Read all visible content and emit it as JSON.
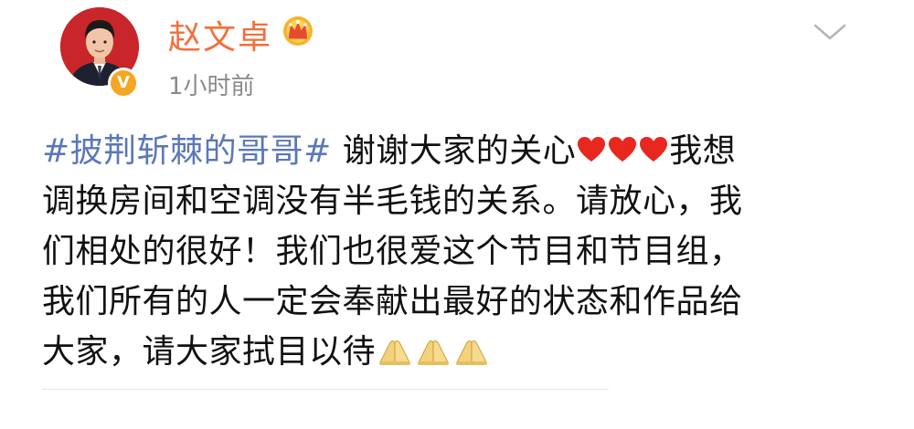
{
  "post": {
    "username": "赵文卓",
    "time": "1小时前",
    "avatar_icon": "user-avatar-photo",
    "verified_icon": "verified-v-badge",
    "crown_icon": "crown-badge-icon",
    "menu_icon": "chevron-down-icon",
    "content": {
      "topic": "#披荆斩棘的哥哥#",
      "line1_text": " 谢谢大家的关心",
      "heart_count": 3,
      "line1_after": "我想",
      "line2": "调换房间和空调没有半毛钱的关系。请放心，我",
      "line3": "们相处的很好！我们也很爱这个节目和节目组，",
      "line4": "我们所有的人一定会奉献出最好的状态和作品给",
      "line5_text": "大家，请大家拭目以待",
      "hands_count": 3
    }
  },
  "colors": {
    "username": "#f0703a",
    "topic": "#5b78b8",
    "time": "#8a8a8a",
    "heart": "#e8271f",
    "verified": "#f5a623"
  }
}
